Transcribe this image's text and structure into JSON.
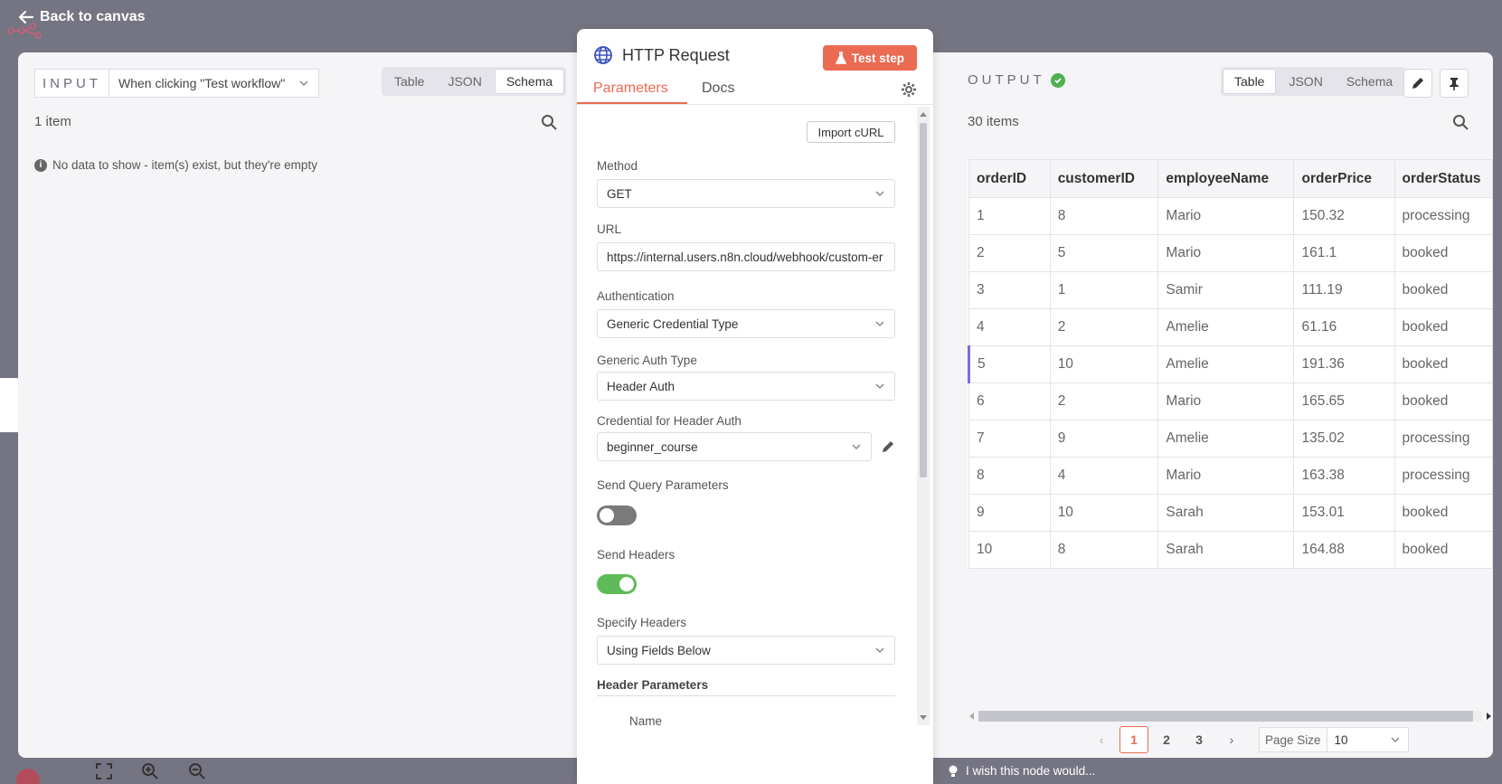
{
  "back_label": "Back to canvas",
  "input": {
    "label": "INPUT",
    "trigger": "When clicking \"Test workflow\"",
    "views": [
      "Table",
      "JSON",
      "Schema"
    ],
    "active_view": "Schema",
    "count": "1 item",
    "no_data": "No data to show - item(s) exist, but they're empty"
  },
  "node": {
    "title": "HTTP Request",
    "test_step": "Test step",
    "tabs": [
      "Parameters",
      "Docs"
    ],
    "import_curl": "Import cURL",
    "method_label": "Method",
    "method_value": "GET",
    "url_label": "URL",
    "url_value": "https://internal.users.n8n.cloud/webhook/custom-er",
    "auth_label": "Authentication",
    "auth_value": "Generic Credential Type",
    "generic_auth_label": "Generic Auth Type",
    "generic_auth_value": "Header Auth",
    "credential_label": "Credential for Header Auth",
    "credential_value": "beginner_course",
    "send_query_label": "Send Query Parameters",
    "send_query_on": false,
    "send_headers_label": "Send Headers",
    "send_headers_on": true,
    "specify_headers_label": "Specify Headers",
    "specify_headers_value": "Using Fields Below",
    "header_params_label": "Header Parameters",
    "name_label": "Name"
  },
  "output": {
    "label": "OUTPUT",
    "views": [
      "Table",
      "JSON",
      "Schema"
    ],
    "active_view": "Table",
    "count": "30 items",
    "columns": [
      "orderID",
      "customerID",
      "employeeName",
      "orderPrice",
      "orderStatus"
    ],
    "rows": [
      [
        "1",
        "8",
        "Mario",
        "150.32",
        "processing"
      ],
      [
        "2",
        "5",
        "Mario",
        "161.1",
        "booked"
      ],
      [
        "3",
        "1",
        "Samir",
        "111.19",
        "booked"
      ],
      [
        "4",
        "2",
        "Amelie",
        "61.16",
        "booked"
      ],
      [
        "5",
        "10",
        "Amelie",
        "191.36",
        "booked"
      ],
      [
        "6",
        "2",
        "Mario",
        "165.65",
        "booked"
      ],
      [
        "7",
        "9",
        "Amelie",
        "135.02",
        "processing"
      ],
      [
        "8",
        "4",
        "Mario",
        "163.38",
        "processing"
      ],
      [
        "9",
        "10",
        "Sarah",
        "153.01",
        "booked"
      ],
      [
        "10",
        "8",
        "Sarah",
        "164.88",
        "booked"
      ]
    ],
    "pages": [
      "1",
      "2",
      "3"
    ],
    "active_page": "1",
    "page_size_label": "Page Size",
    "page_size_value": "10"
  },
  "feedback": "I wish this node would...",
  "colors": {
    "accent": "#ea6a52",
    "success": "#5fbb5a",
    "backdrop": "#757482"
  }
}
